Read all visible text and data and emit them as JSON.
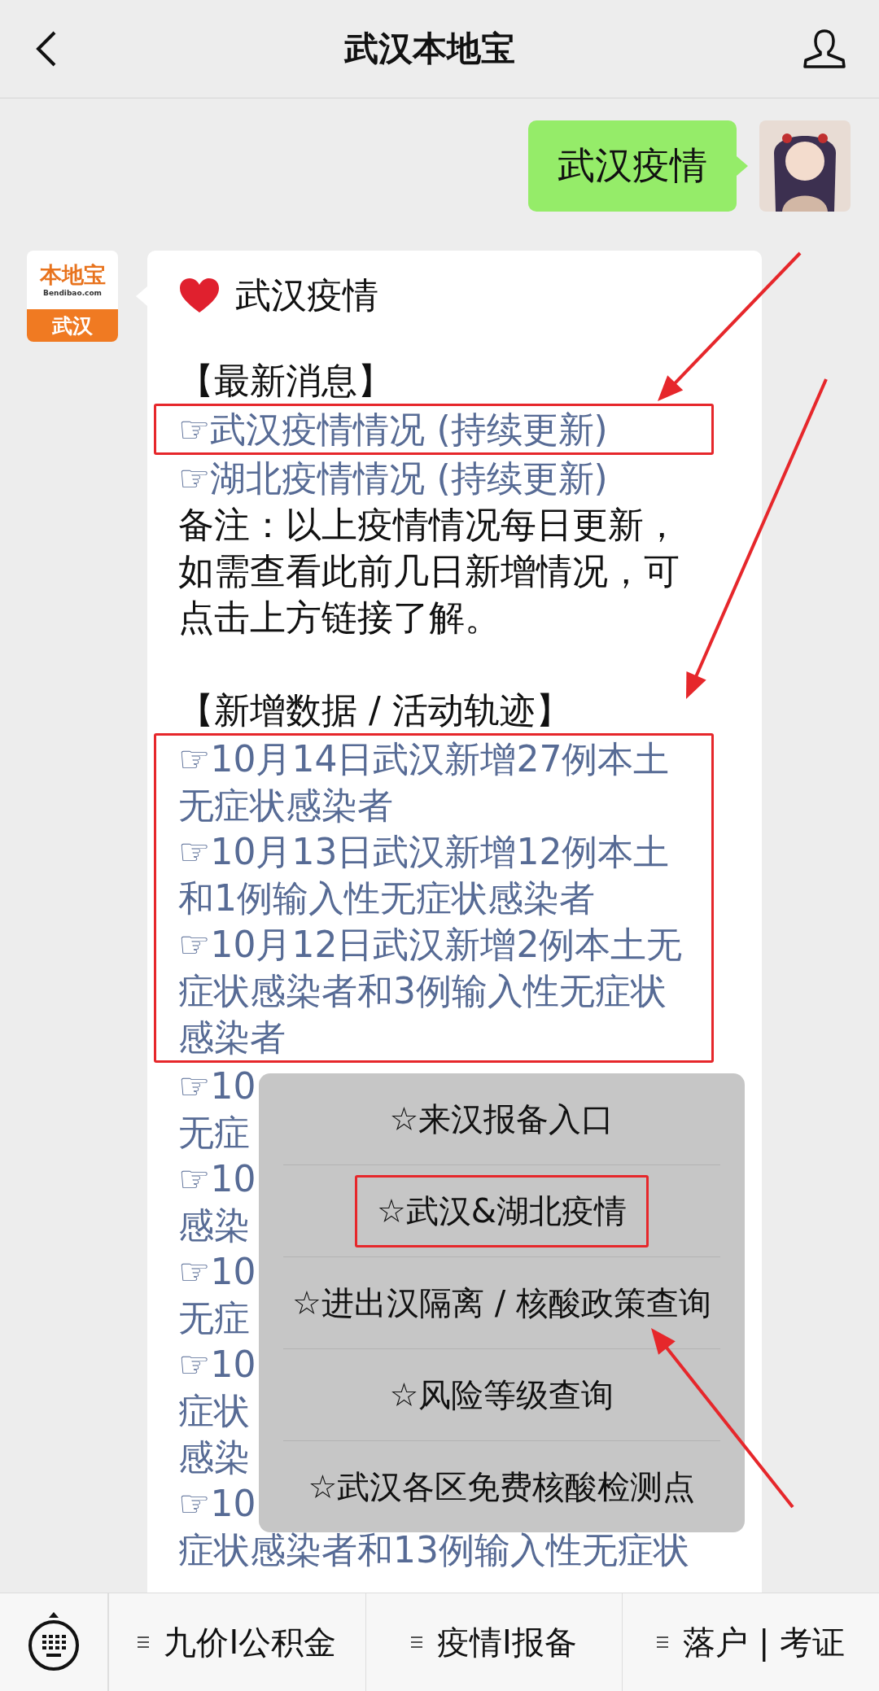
{
  "header": {
    "title": "武汉本地宝"
  },
  "user_message": {
    "text": "武汉疫情"
  },
  "bot_avatar": {
    "logo_text": "本地宝",
    "domain": "Bendibao.com",
    "city": "武汉"
  },
  "bot_message": {
    "title": "武汉疫情",
    "blocks": [
      {
        "kind": "text",
        "text": "【最新消息】"
      },
      {
        "kind": "link",
        "text": "☞武汉疫情情况 (持续更新)",
        "annotated": true
      },
      {
        "kind": "link",
        "text": "☞湖北疫情情况 (持续更新)"
      },
      {
        "kind": "text",
        "text": "备注：以上疫情情况每日更新，如需查看此前几日新增情况，可点击上方链接了解。"
      },
      {
        "kind": "gap"
      },
      {
        "kind": "text",
        "text": "【新增数据 / 活动轨迹】"
      },
      {
        "kind": "link",
        "text": "☞10月14日武汉新增27例本土无症状感染者",
        "annotated": true
      },
      {
        "kind": "link",
        "text": "☞10月13日武汉新增12例本土和1例输入性无症状感染者",
        "annotated": true
      },
      {
        "kind": "link",
        "text": "☞10月12日武汉新增2例本土无症状感染者和3例输入性无症状感染者",
        "annotated": true
      },
      {
        "kind": "partial",
        "lines": [
          "☞10",
          "无症"
        ]
      },
      {
        "kind": "partial",
        "lines": [
          "☞10",
          "感染"
        ]
      },
      {
        "kind": "partial",
        "lines": [
          "☞10",
          "无症"
        ]
      },
      {
        "kind": "partial",
        "lines": [
          "☞10",
          "症状",
          "感染"
        ]
      },
      {
        "kind": "partial",
        "lines": [
          "☞10",
          "症状感染者和13例输入性无症状"
        ]
      }
    ]
  },
  "popup_menu": [
    {
      "text": "☆来汉报备入口",
      "annotated": false
    },
    {
      "text": "☆武汉&湖北疫情",
      "annotated": true
    },
    {
      "text": "☆进出汉隔离 / 核酸政策查询",
      "annotated": false
    },
    {
      "text": "☆风险等级查询",
      "annotated": false
    },
    {
      "text": "☆武汉各区免费核酸检测点",
      "annotated": false
    }
  ],
  "bottom_menu": [
    "九价I公积金",
    "疫情I报备",
    "落户 | 考证"
  ]
}
